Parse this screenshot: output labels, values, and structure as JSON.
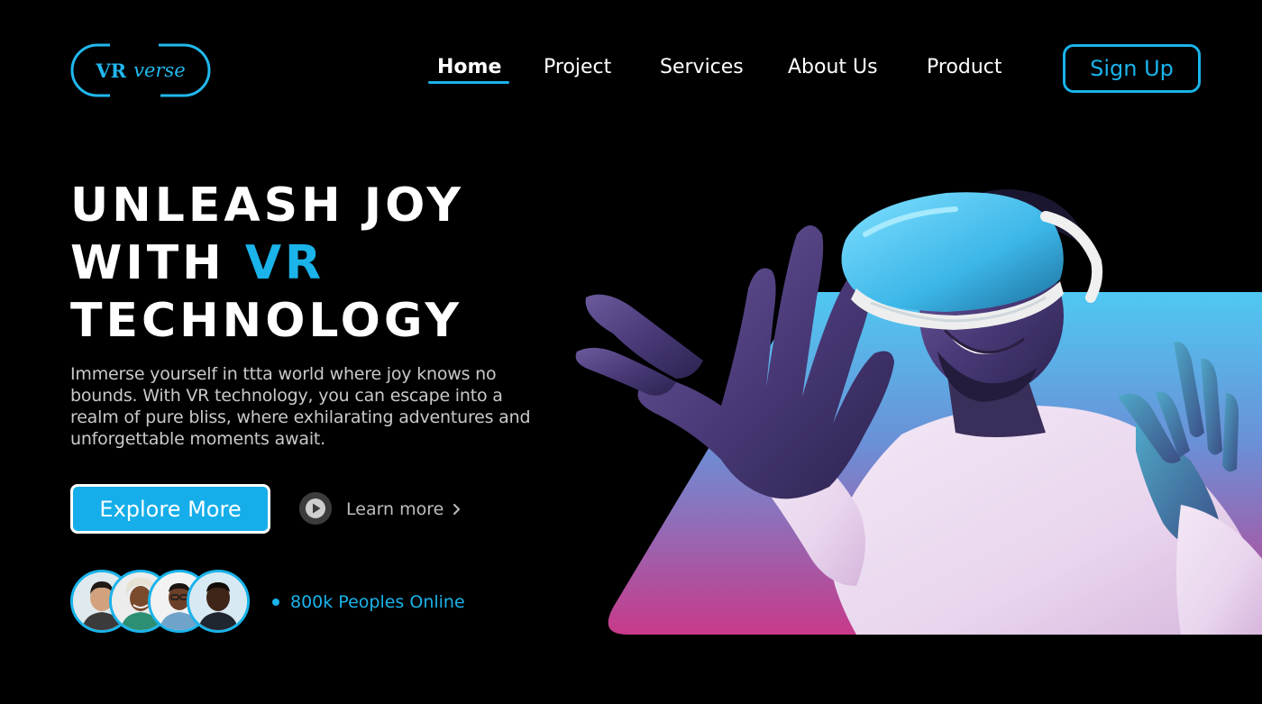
{
  "brand": {
    "logo_main": "VR",
    "logo_sub": "verse"
  },
  "nav": {
    "items": [
      {
        "label": "Home",
        "active": true
      },
      {
        "label": "Project",
        "active": false
      },
      {
        "label": "Services",
        "active": false
      },
      {
        "label": "About Us",
        "active": false
      },
      {
        "label": "Product",
        "active": false
      }
    ],
    "signup_label": "Sign Up"
  },
  "hero": {
    "title_line1": "UNLEASH JOY",
    "title_line2_prefix": "WITH ",
    "title_line2_accent": "VR",
    "title_line3": "TECHNOLOGY",
    "description": "Immerse yourself in ttta world where joy knows no bounds. With VR technology, you can escape into a realm of pure bliss, where exhilarating adventures and unforgettable moments await.",
    "primary_cta": "Explore More",
    "secondary_cta": "Learn more"
  },
  "community": {
    "online_text": "800k Peoples Online",
    "avatar_count": 4
  },
  "colors": {
    "accent": "#1ab3ea",
    "background": "#000000",
    "gradient_top": "#4fc8f2",
    "gradient_bottom": "#c83a8a"
  },
  "icons": [
    "play-icon",
    "chevron-right-icon",
    "online-dot-icon"
  ]
}
